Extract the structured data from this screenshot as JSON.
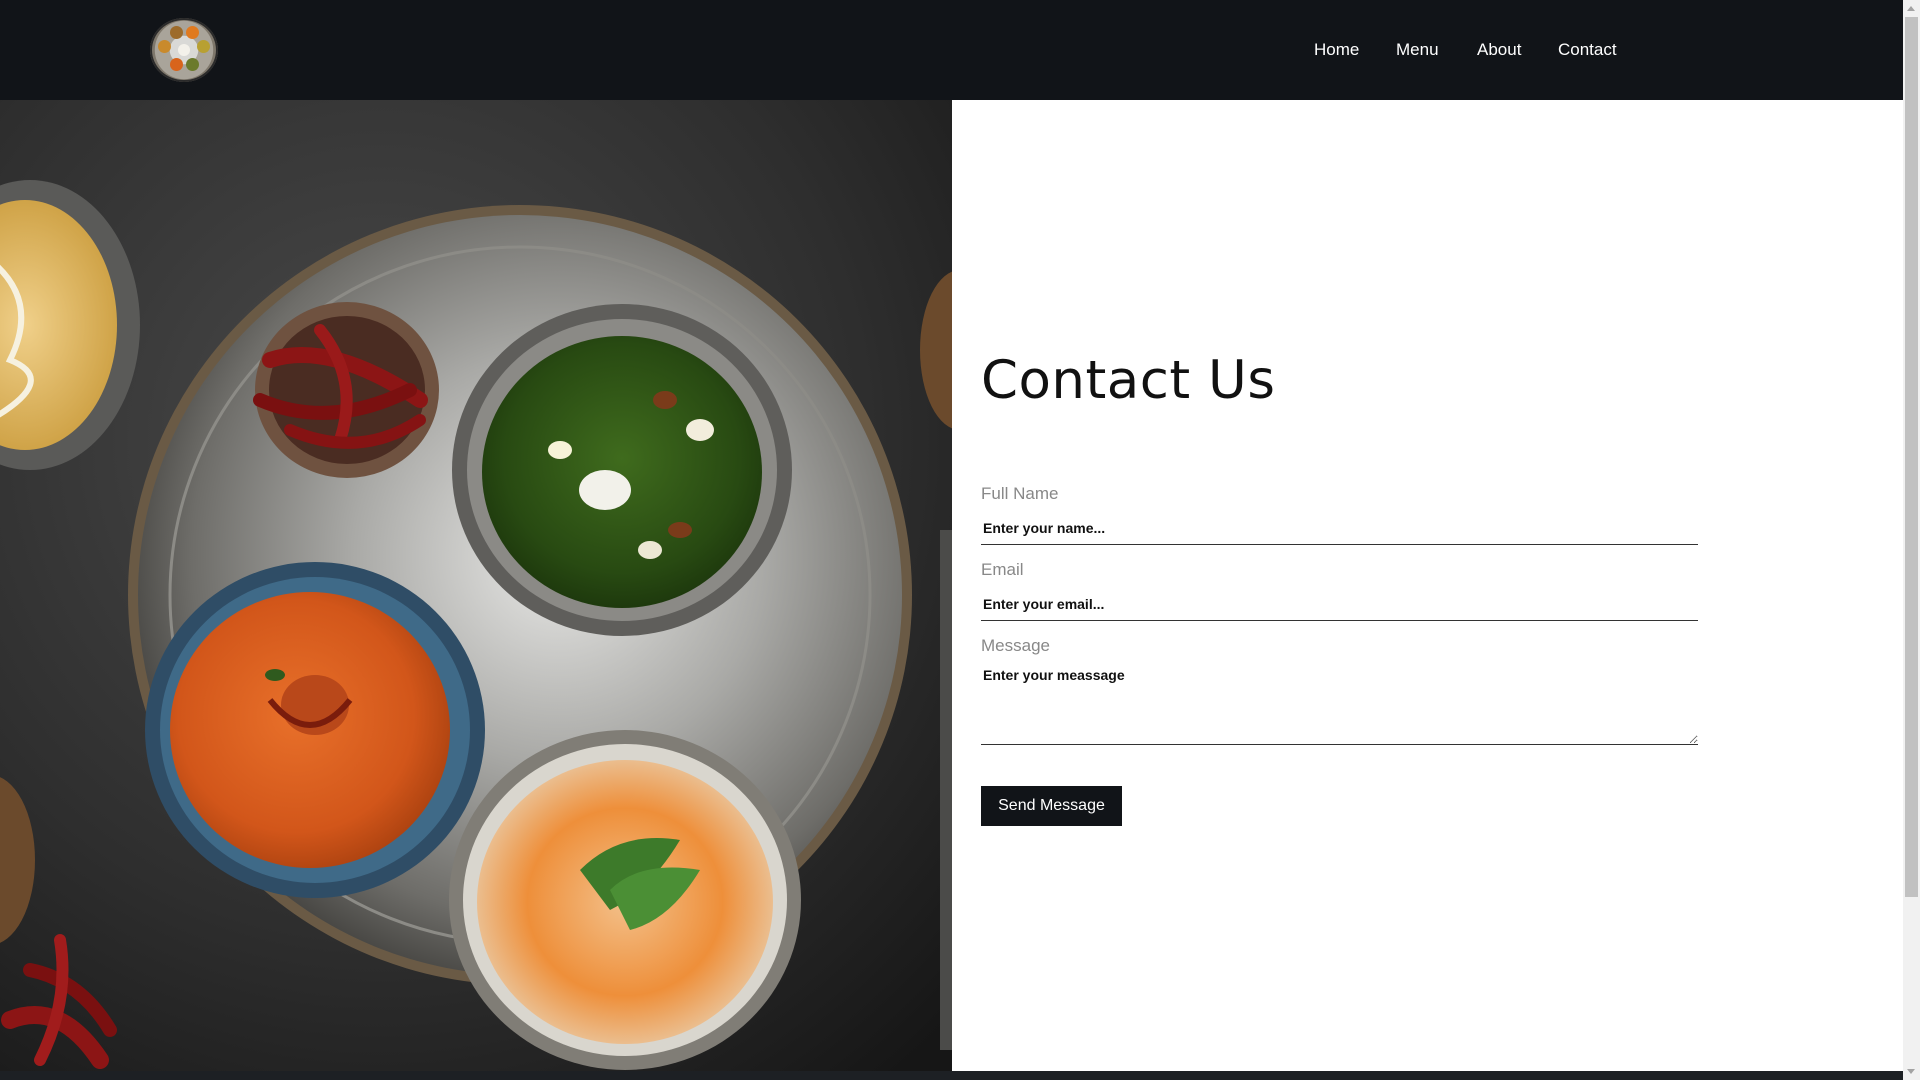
{
  "header": {
    "logo_icon": "thali-plate-logo",
    "nav": [
      {
        "label": "Home"
      },
      {
        "label": "Menu"
      },
      {
        "label": "About"
      },
      {
        "label": "Contact"
      }
    ]
  },
  "hero": {
    "image_icon": "indian-food-thali-photo"
  },
  "contact": {
    "title": "Contact Us",
    "fields": {
      "name": {
        "label": "Full Name",
        "placeholder": "Enter your name..."
      },
      "email": {
        "label": "Email",
        "placeholder": "Enter your email..."
      },
      "message": {
        "label": "Message",
        "placeholder": "Enter your meassage"
      }
    },
    "submit_label": "Send Message"
  },
  "colors": {
    "header_bg": "#111418",
    "button_bg": "#111418",
    "page_bg": "#ffffff"
  }
}
